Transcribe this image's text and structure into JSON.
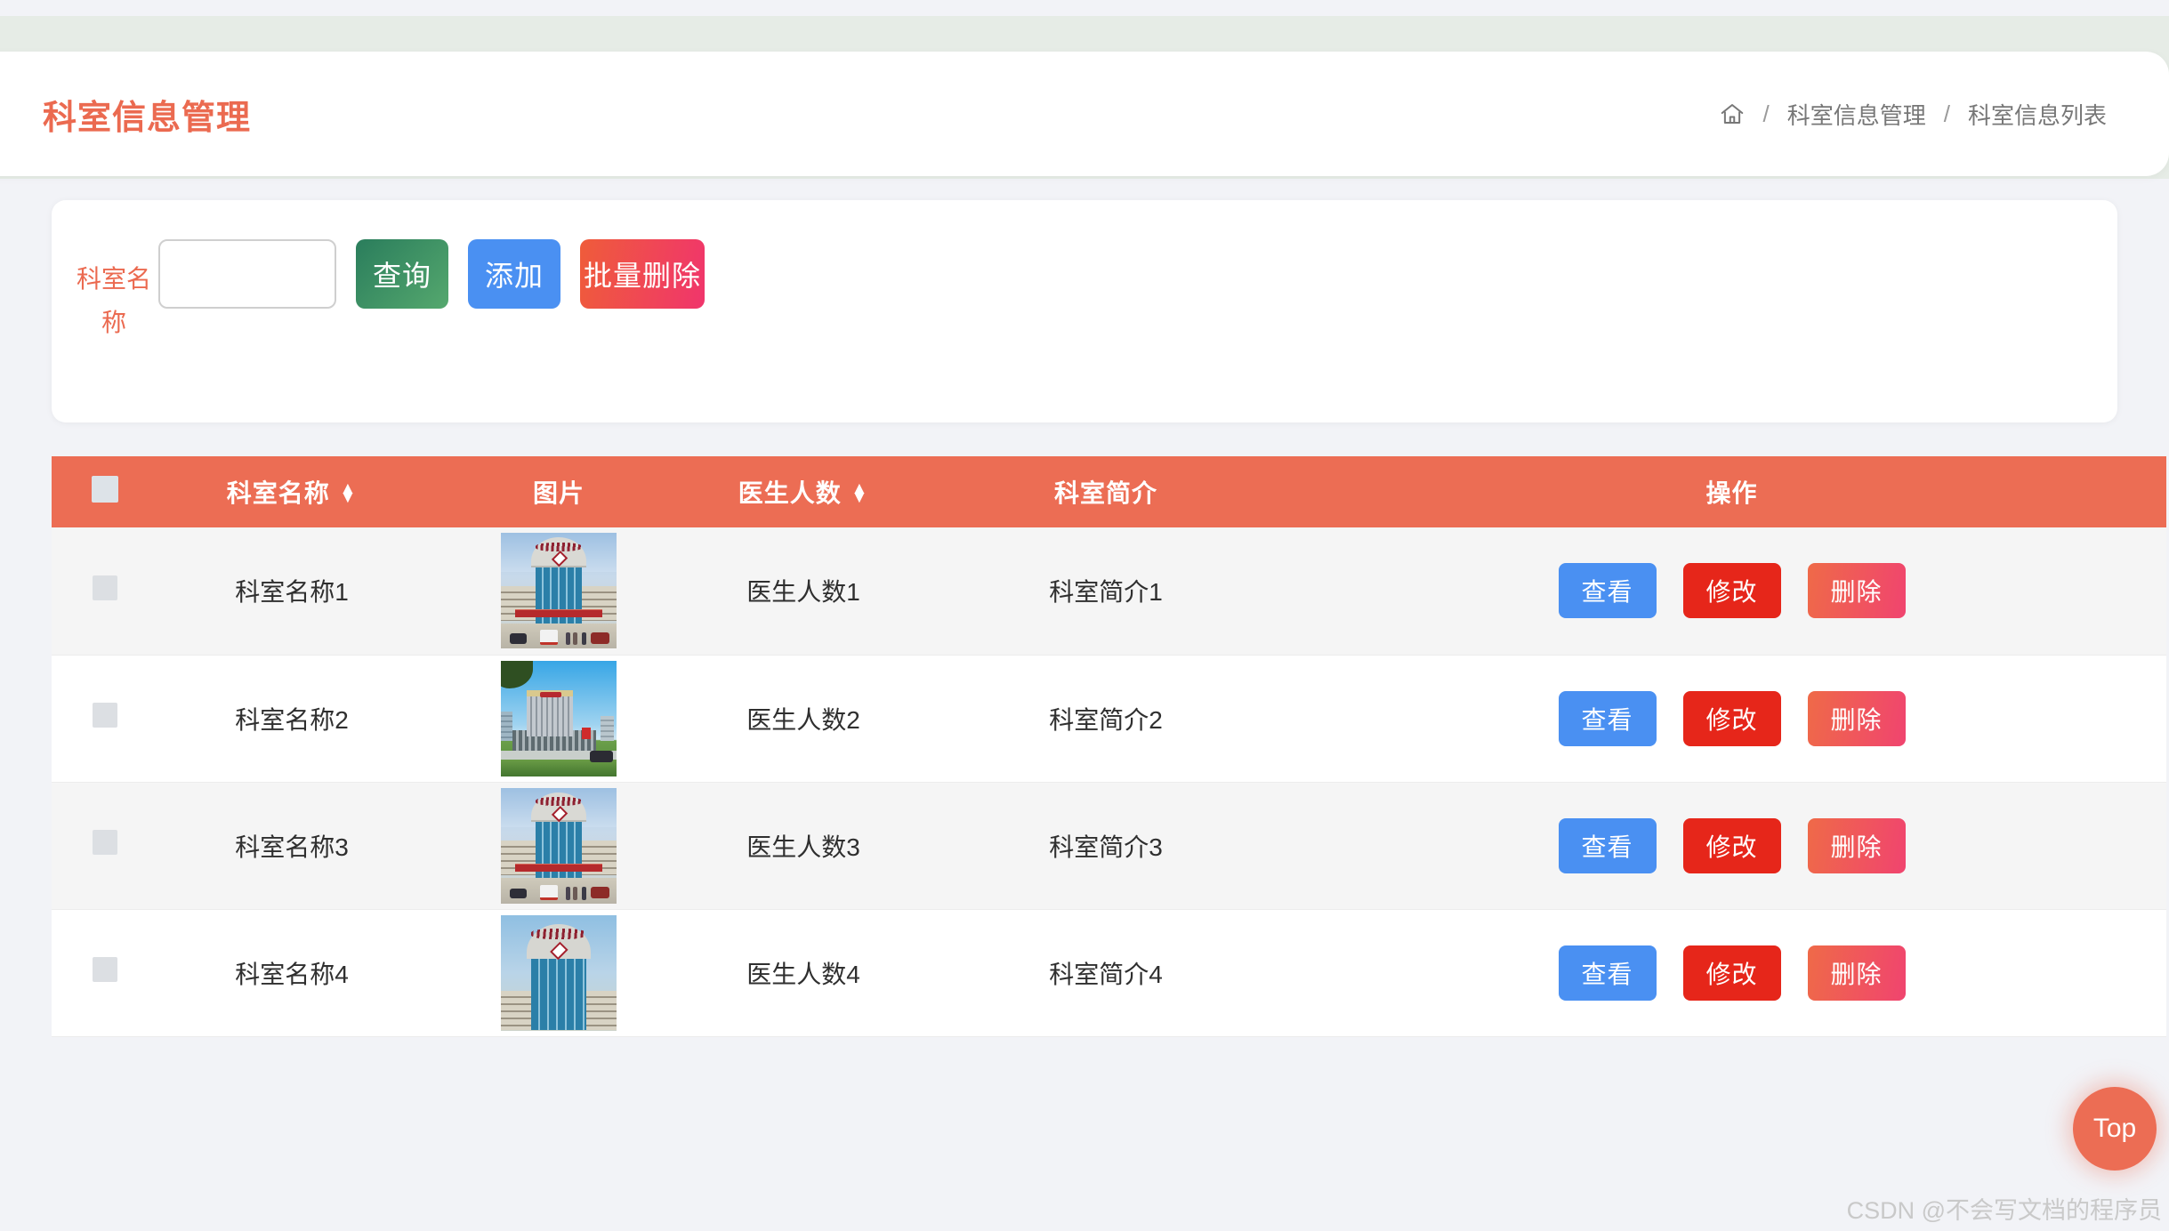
{
  "header": {
    "title": "科室信息管理",
    "breadcrumb": {
      "home_icon": "home-icon",
      "sep1": "/",
      "item1": "科室信息管理",
      "sep2": "/",
      "item2": "科室信息列表"
    }
  },
  "filter": {
    "label": "科室名称",
    "input_value": "",
    "input_placeholder": "",
    "buttons": {
      "query": "查询",
      "add": "添加",
      "batch_delete": "批量删除"
    }
  },
  "table": {
    "select_all": "select-all-checkbox",
    "columns": [
      {
        "label": "",
        "sortable": false
      },
      {
        "label": "科室名称",
        "sortable": true
      },
      {
        "label": "图片",
        "sortable": false
      },
      {
        "label": "医生人数",
        "sortable": true
      },
      {
        "label": "科室简介",
        "sortable": false
      },
      {
        "label": "操作",
        "sortable": false
      }
    ],
    "sort_glyph_up": "▲",
    "sort_glyph_down": "▼",
    "row_actions": {
      "view": "查看",
      "edit": "修改",
      "delete": "删除"
    },
    "rows": [
      {
        "name": "科室名称1",
        "image": "hospital-entrance-photo",
        "doctors": "医生人数1",
        "intro": "科室简介1"
      },
      {
        "name": "科室名称2",
        "image": "hospital-rendering-photo",
        "doctors": "医生人数2",
        "intro": "科室简介2"
      },
      {
        "name": "科室名称3",
        "image": "hospital-entrance-photo",
        "doctors": "医生人数3",
        "intro": "科室简介3"
      },
      {
        "name": "科室名称4",
        "image": "hospital-entrance-photo",
        "doctors": "医生人数4",
        "intro": "科室简介4"
      }
    ]
  },
  "floating": {
    "top_button": "Top"
  },
  "watermark": "CSDN @不会写文档的程序员",
  "colors": {
    "accent": "#ec6d54",
    "title": "#eb6a50",
    "blue": "#4a90f2",
    "red": "#e6261a",
    "green_dark": "#2a7d5c",
    "green_light": "#55a86e",
    "pink": "#f0356c",
    "page_bg": "#f2f3f7",
    "header_band": "#e6ece6",
    "row_alt": "#f5f5f5"
  }
}
